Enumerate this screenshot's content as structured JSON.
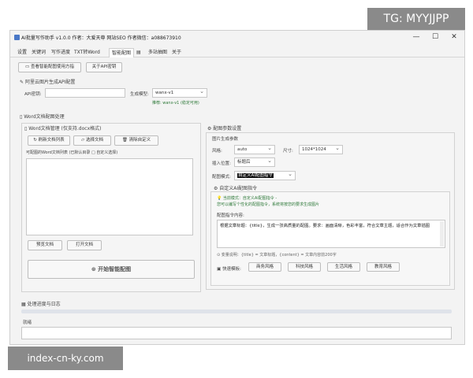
{
  "overlay": {
    "tg": "TG: MYYJJPP",
    "url": "index-cn-ky.com"
  },
  "window": {
    "title": "AI批量写作助手 v1.0.0 作者：大爱天尊 网站SEO 作者微信：a088673910",
    "controls": {
      "minimize": "—",
      "maximize": "☐",
      "close": "✕"
    }
  },
  "tabs": [
    "设置",
    "关键词",
    "写作进度",
    "TXT转Word",
    "智能配图",
    "▤",
    "多站抽图",
    "关于"
  ],
  "actions": {
    "guide": "查看智能配图使用方指",
    "api_help": "关于API密钥"
  },
  "api_section": {
    "title": "阿里云图片生成API配置",
    "key_label": "API密钥:",
    "key_value": "",
    "model_label": "生成模型:",
    "model_value": "wanx-v1",
    "hint": "推荐: wanx-v1 (稳定可用)"
  },
  "word_section": {
    "title": "Word文档配图处理"
  },
  "doc_mgmt": {
    "title": "Word文档管理 (仅支持.docx格式)",
    "refresh": "刷新文档列表",
    "select": "选择文档",
    "clear": "清除自定义",
    "list_label": "可配图的Word文档列表 (已默认目录 □ 自定义选择)",
    "preview": "预览文档",
    "open": "打开文档",
    "start": "开始智能配图"
  },
  "params": {
    "title": "配图参数设置",
    "gen_params": "图片生成参数",
    "style_label": "风格:",
    "style_value": "auto",
    "size_label": "尺寸:",
    "size_value": "1024*1024",
    "pos_label": "插入位置:",
    "pos_value": "标题后",
    "mode_label": "配图模式:",
    "mode_value": "自定义AI配图指令"
  },
  "custom": {
    "title": "自定义AI配图指令",
    "mode_note": "当前模式：自定义AI配图指令 -",
    "mode_desc": "您可以编写个性化的配图指令，系统将按您的要求生成图片",
    "content_label": "配图指令内容:",
    "content_value": "根据文章标题：{title}，生成一张高质量的配图。要求：画面清晰，色彩丰富，符合文章主题，适合作为文章插图",
    "vars_hint": "变量说明：{title} = 文章标题，{content} = 文章内容前200字",
    "quick_label": "快速模板:",
    "templates": [
      "商务风格",
      "科技风格",
      "生活风格",
      "教育风格"
    ]
  },
  "progress": {
    "title": "处理进度与日志",
    "status": "就绪"
  }
}
